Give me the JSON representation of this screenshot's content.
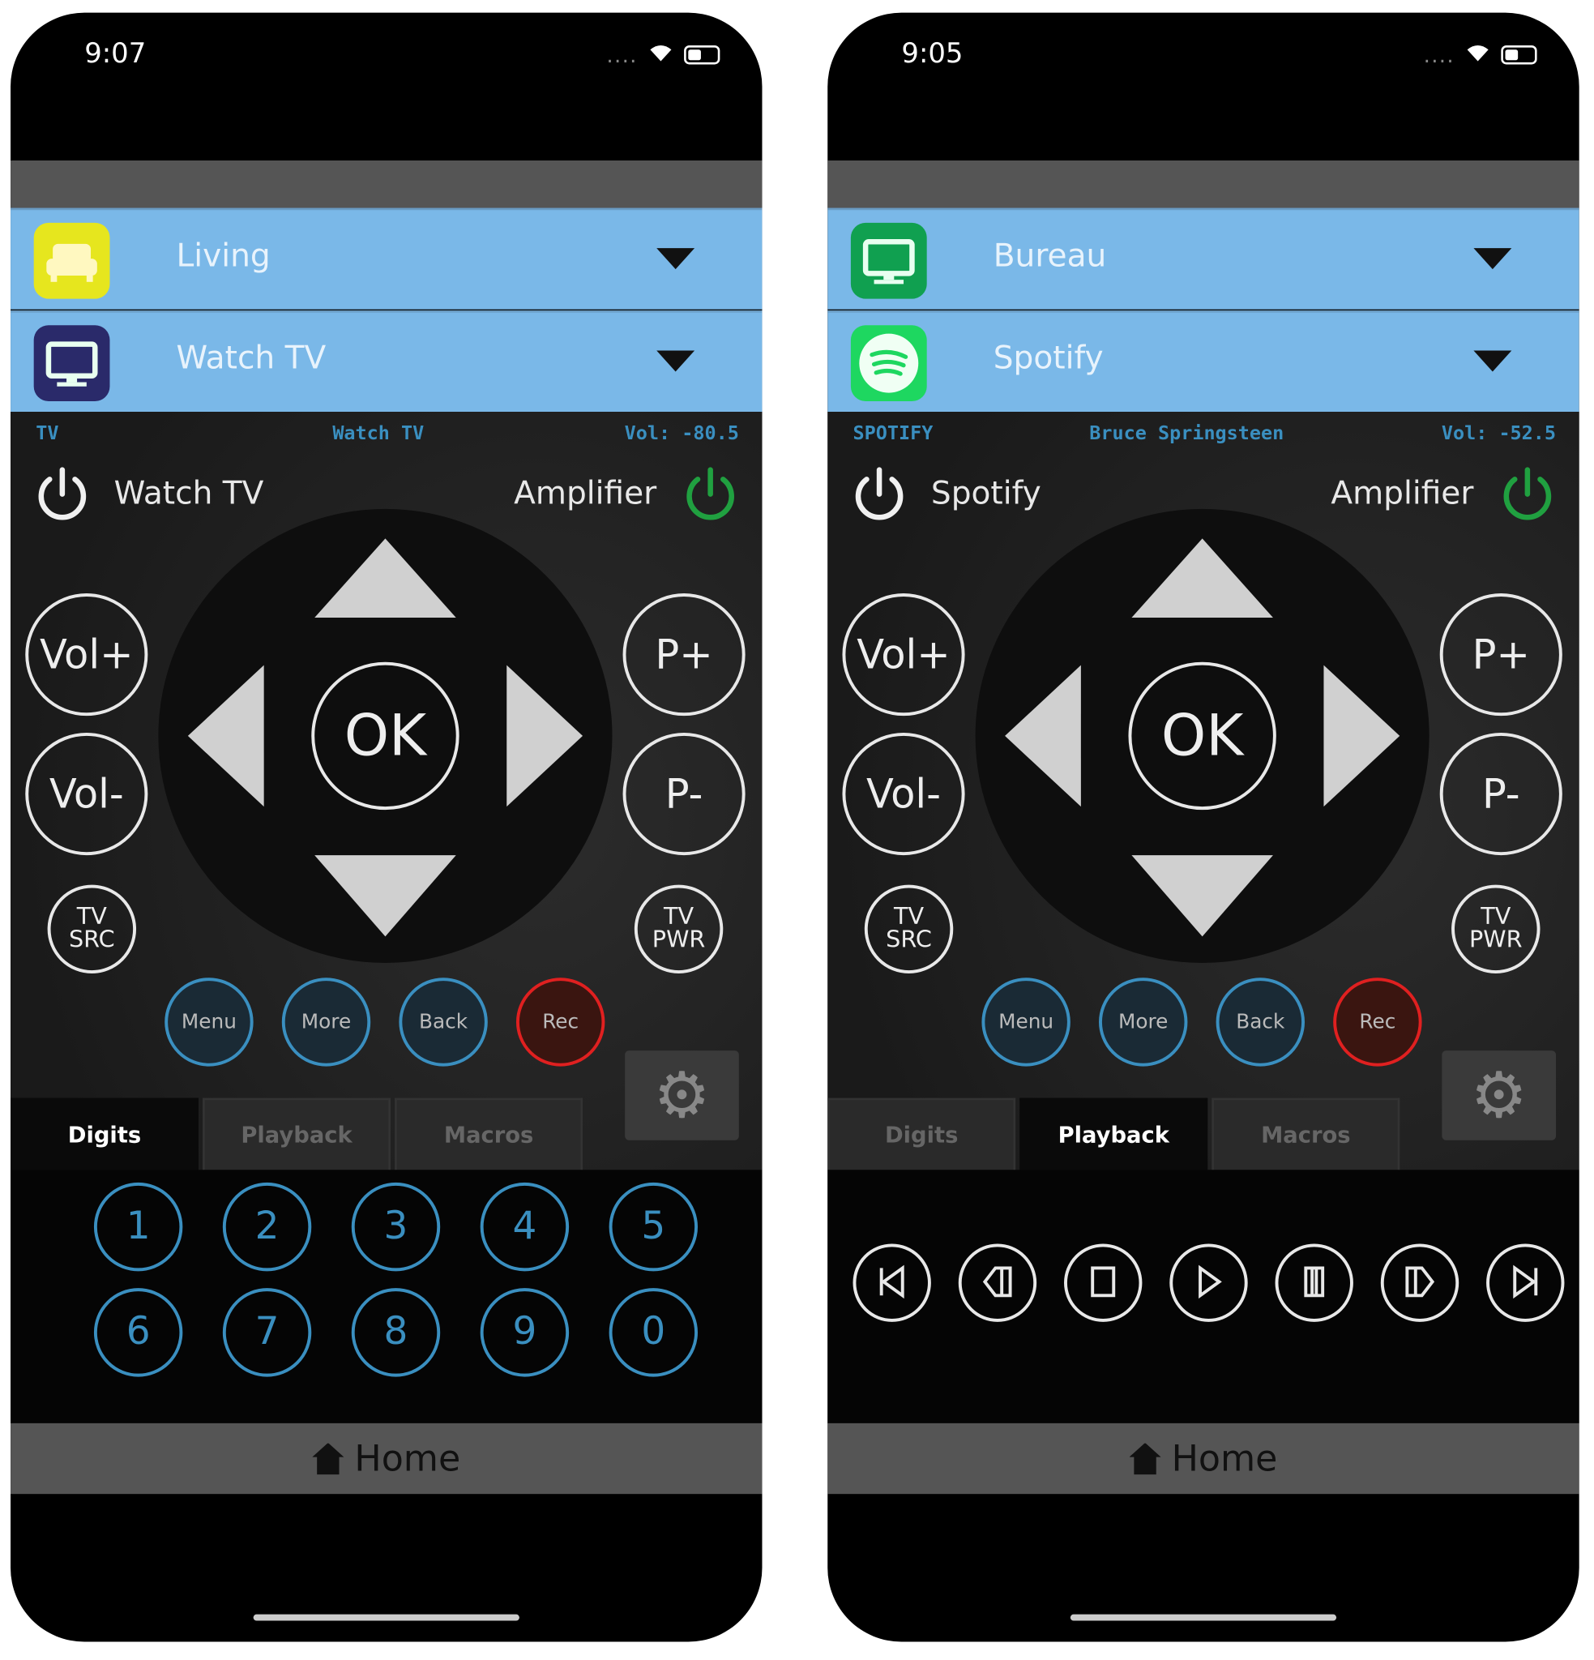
{
  "phones": [
    {
      "status_time": "9:07",
      "room": {
        "label": "Living",
        "icon": "sofa-icon",
        "icon_color": "#e6e61e"
      },
      "activity": {
        "label": "Watch TV",
        "icon": "monitor-icon",
        "icon_color": "#2a2a6a"
      },
      "info": {
        "source": "TV",
        "now_playing": "Watch TV",
        "volume": "Vol: -80.5"
      },
      "power_label": "Watch TV",
      "amp_label": "Amplifier",
      "active_tab": 0,
      "panel": "digits"
    },
    {
      "status_time": "9:05",
      "room": {
        "label": "Bureau",
        "icon": "monitor-icon",
        "icon_color": "#10a050"
      },
      "activity": {
        "label": "Spotify",
        "icon": "spotify-icon",
        "icon_color": "#1ed760"
      },
      "info": {
        "source": "SPOTIFY",
        "now_playing": "Bruce Springsteen",
        "volume": "Vol: -52.5"
      },
      "power_label": "Spotify",
      "amp_label": "Amplifier",
      "active_tab": 1,
      "panel": "playback"
    }
  ],
  "remote": {
    "ok": "OK",
    "vol_up": "Vol+",
    "vol_down": "Vol-",
    "ch_up": "P+",
    "ch_down": "P-",
    "tv_src": "TV SRC",
    "tv_pwr": "TV PWR",
    "menu": "Menu",
    "more": "More",
    "back": "Back",
    "rec": "Rec"
  },
  "tabs": [
    "Digits",
    "Playback",
    "Macros"
  ],
  "digits": [
    "1",
    "2",
    "3",
    "4",
    "5",
    "6",
    "7",
    "8",
    "9",
    "0"
  ],
  "playback": [
    "skip-back-icon",
    "rewind-icon",
    "stop-icon",
    "play-icon",
    "pause-icon",
    "fast-forward-icon",
    "skip-forward-icon"
  ],
  "home_label": "Home",
  "colors": {
    "accent_blue": "#3a8fc0",
    "rec_red": "#e02020",
    "power_green": "#20a040",
    "header_blue": "#7ab8e8"
  }
}
